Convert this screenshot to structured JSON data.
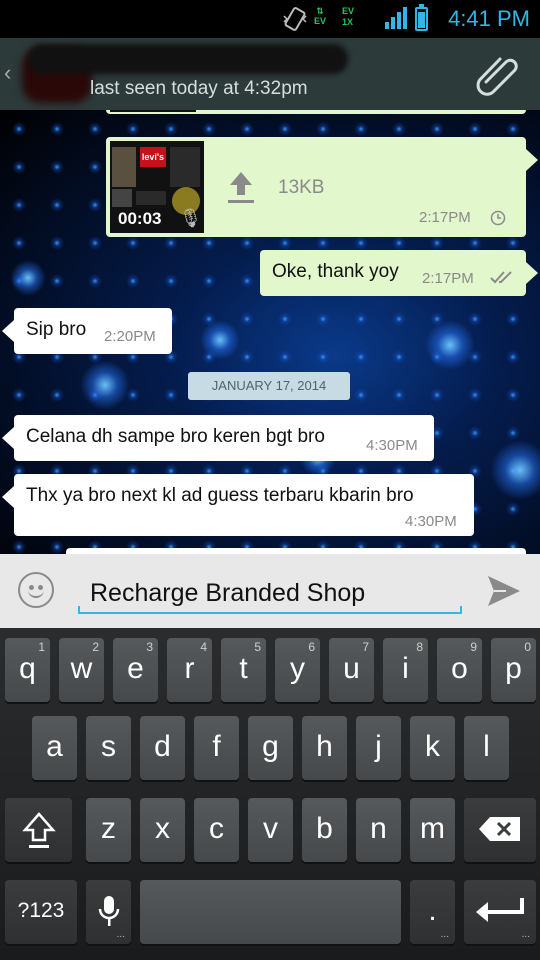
{
  "status_bar": {
    "time": "4:41 PM",
    "network_ev_label": "EV",
    "network_evdo_label": "EV",
    "network_1x_label": "1X",
    "icons": [
      "vibrate-icon",
      "data-arrows-icon",
      "signal-icon",
      "battery-icon"
    ]
  },
  "header": {
    "contact_name": "",
    "last_seen": "last seen today at 4:32pm",
    "icons": [
      "back-icon",
      "attach-icon"
    ]
  },
  "chat": {
    "messages": [
      {
        "direction": "out",
        "type": "video",
        "duration": "00:03",
        "size": "13KB",
        "time": "2:17PM",
        "status_icon": "clock-icon",
        "thumb_brand": "levi's"
      },
      {
        "direction": "out",
        "type": "text",
        "text": "Oke, thank yoy",
        "time": "2:17PM",
        "status_icon": "double-check-icon"
      },
      {
        "direction": "in",
        "type": "text",
        "text": "Sip bro",
        "time": "2:20PM"
      },
      {
        "direction": "in",
        "type": "text",
        "text": "Celana dh sampe bro keren bgt bro",
        "time": "4:30PM"
      },
      {
        "direction": "in",
        "type": "text",
        "text": "Thx ya bro next kl ad guess terbaru kbarin bro",
        "time": "4:30PM"
      }
    ],
    "date_divider": "JANUARY 17, 2014"
  },
  "composer": {
    "value": "Recharge Branded Shop",
    "icons": [
      "emoji-icon",
      "send-icon"
    ]
  },
  "keyboard": {
    "row1": [
      {
        "key": "q",
        "hint": "1"
      },
      {
        "key": "w",
        "hint": "2"
      },
      {
        "key": "e",
        "hint": "3"
      },
      {
        "key": "r",
        "hint": "4"
      },
      {
        "key": "t",
        "hint": "5"
      },
      {
        "key": "y",
        "hint": "6"
      },
      {
        "key": "u",
        "hint": "7"
      },
      {
        "key": "i",
        "hint": "8"
      },
      {
        "key": "o",
        "hint": "9"
      },
      {
        "key": "p",
        "hint": "0"
      }
    ],
    "row2": [
      "a",
      "s",
      "d",
      "f",
      "g",
      "h",
      "j",
      "k",
      "l"
    ],
    "row3": [
      "z",
      "x",
      "c",
      "v",
      "b",
      "n",
      "m"
    ],
    "symbols_label": "?123",
    "period_label": ".",
    "more_dots": "...",
    "colors": {
      "accent": "#33b5e5",
      "bubble_out": "#e2f7cc",
      "bubble_in": "#ffffff"
    }
  }
}
